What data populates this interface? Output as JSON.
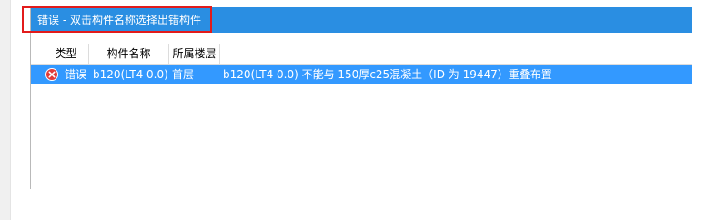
{
  "window": {
    "title": "错误 - 双击构件名称选择出错构件"
  },
  "table": {
    "columns": [
      "类型",
      "构件名称",
      "所属楼层"
    ],
    "rows": [
      {
        "icon": "error-icon",
        "type": "错误",
        "component_name": "b120(LT4  0.0)",
        "floor": "首层",
        "message": "b120(LT4  0.0) 不能与 150厚c25混凝土（ID 为 19447）重叠布置"
      }
    ]
  },
  "colors": {
    "title_bar": "#2a8ee2",
    "selected_row": "#3399ff",
    "highlight_border": "#e21b1b",
    "error_icon": "#e23b3b"
  }
}
